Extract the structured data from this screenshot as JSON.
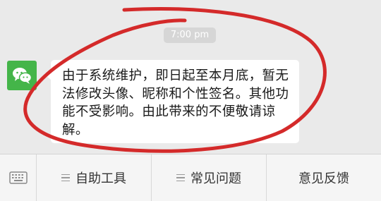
{
  "chat": {
    "timestamp": "7:00 pm",
    "message": {
      "avatar_icon": "wechat-icon",
      "text": "由于系统维护，即日起至本月底，暂无法修改头像、昵称和个性签名。其他功能不受影响。由此带来的不便敬请谅解。"
    }
  },
  "menu_bar": {
    "keyboard_icon": "keyboard-icon",
    "items": [
      {
        "label": "自助工具",
        "icon": "menu-lines-icon"
      },
      {
        "label": "常见问题",
        "icon": "menu-lines-icon"
      },
      {
        "label": "意见反馈"
      }
    ]
  },
  "colors": {
    "avatar_green": "#44b549",
    "annotation_red": "#d42a2a",
    "chat_background": "#eaeaea",
    "bubble": "#ffffff"
  }
}
